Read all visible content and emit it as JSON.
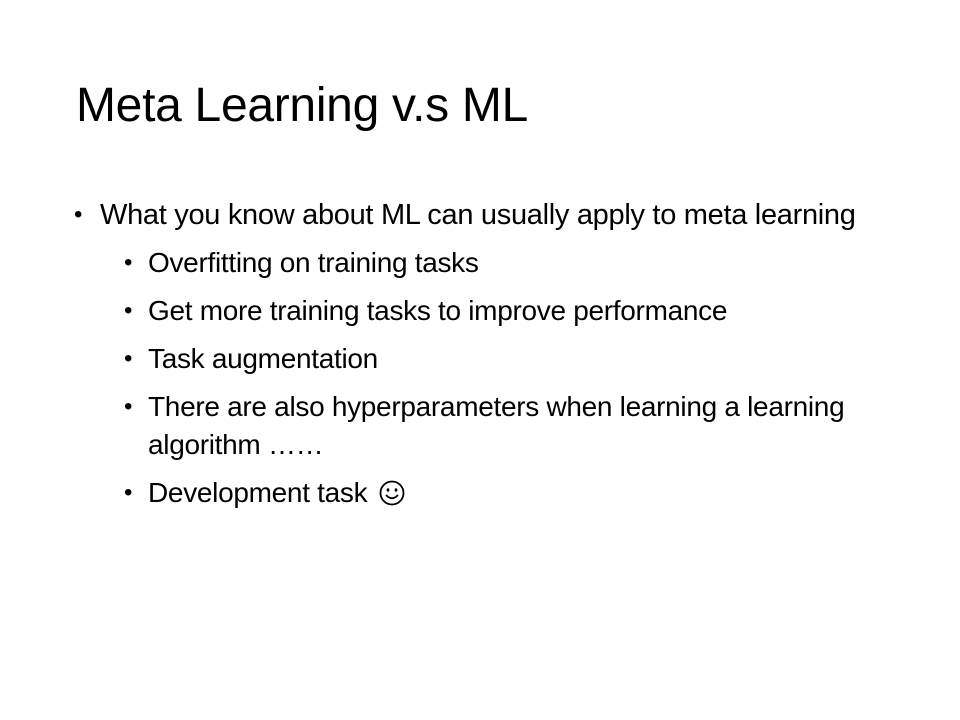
{
  "slide": {
    "title": "Meta Learning v.s ML",
    "bullets": [
      {
        "text": "What you know about ML can usually apply to meta learning",
        "level": 1
      },
      {
        "text": "Overfitting on training tasks",
        "level": 2
      },
      {
        "text": "Get more training tasks to improve performance",
        "level": 2
      },
      {
        "text": "Task augmentation",
        "level": 2
      },
      {
        "text": "There are also hyperparameters when learning a learning algorithm ……",
        "level": 2
      },
      {
        "text": "Development task",
        "level": 2,
        "trailing_icon": "smiley-face-icon"
      }
    ]
  }
}
